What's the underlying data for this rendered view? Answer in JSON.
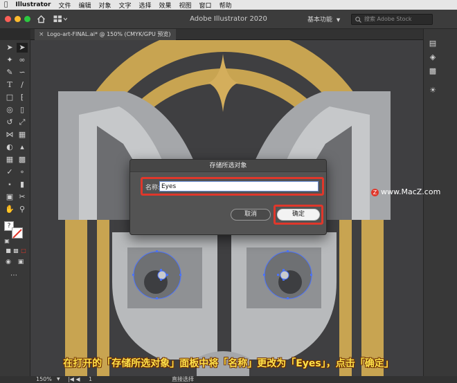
{
  "menubar": {
    "app_name": "Illustrator",
    "items": [
      "文件",
      "编辑",
      "对象",
      "文字",
      "选择",
      "效果",
      "视图",
      "窗口",
      "帮助"
    ]
  },
  "appbar": {
    "title": "Adobe Illustrator 2020",
    "workspace": "基本功能",
    "search_placeholder": "搜索 Adobe Stock"
  },
  "document_tab": {
    "label": "Logo-art-FINAL.ai* @ 150% (CMYK/GPU 预览)"
  },
  "toolbar": {
    "fill_stroke_hint": "?"
  },
  "dialog": {
    "title": "存储所选对象",
    "name_label": "名称:",
    "name_value": "Eyes",
    "cancel_label": "取消",
    "ok_label": "确定"
  },
  "statusbar": {
    "zoom": "150%",
    "artboard_number": "1",
    "tool_name": "直接选择"
  },
  "watermark": "www.MacZ.com",
  "caption": "在打开的「存储所选对象」面板中将「名称」更改为「Eyes」，点击「确定」",
  "colors": {
    "gold": "#c8a451",
    "canvas_bg": "#3f3f41",
    "highlight_red": "#e0372b",
    "selection_blue": "#4a72ff"
  }
}
